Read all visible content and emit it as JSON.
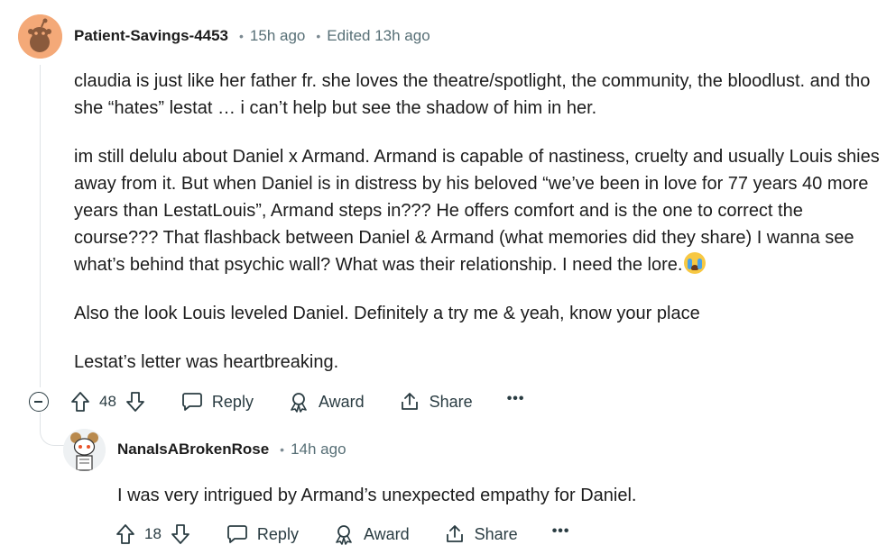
{
  "comment": {
    "username": "Patient-Savings-4453",
    "time": "15h ago",
    "edited": "Edited 13h ago",
    "paragraphs": [
      "claudia is just like her father fr. she loves the theatre/spotlight, the community, the bloodlust. and tho she “hates” lestat … i can’t help but see the shadow of him in her.",
      "im still delulu about Daniel x Armand. Armand is capable of nastiness, cruelty and usually Louis shies away from it. But when Daniel is in distress by his beloved “we’ve been in love for 77 years 40 more years than LestatLouis”, Armand steps in??? He offers comfort and is the one to correct the course??? That flashback between Daniel & Armand (what memories did they share) I wanna see what’s behind that psychic wall? What was their relationship. I need the lore.",
      "Also the look Louis leveled Daniel. Definitely a try me & yeah, know your place",
      "Lestat’s letter was heartbreaking."
    ],
    "emoji_icon": "loudly-crying-face-emoji",
    "votes": "48",
    "reply_label": "Reply",
    "award_label": "Award",
    "share_label": "Share",
    "more_label": "•••"
  },
  "reply": {
    "username": "NanaIsABrokenRose",
    "time": "14h ago",
    "text": "I was very intrigued by Armand’s unexpected empathy for Daniel.",
    "votes": "18",
    "reply_label": "Reply",
    "award_label": "Award",
    "share_label": "Share",
    "more_label": "•••"
  },
  "separator": "•",
  "colors": {
    "avatar1_bg": "#f4a978",
    "meta_gray": "#576f76",
    "thread_line": "#dfe3e6"
  }
}
